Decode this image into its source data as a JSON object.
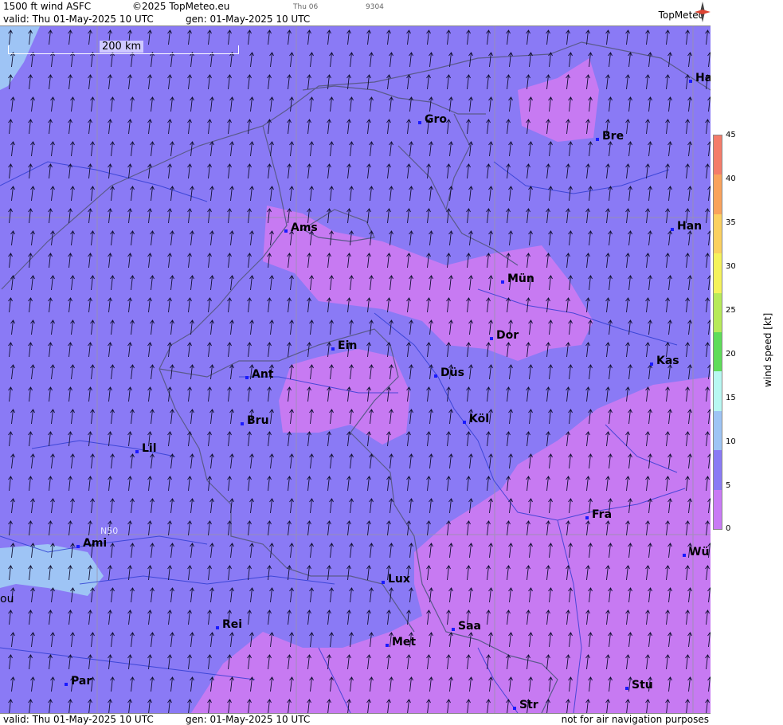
{
  "header": {
    "product": "1500 ft wind ASFC",
    "copyright": "©2025 TopMeteo.eu",
    "valid": "valid:  Thu  01-May-2025  10 UTC",
    "generated": "gen: 01-May-2025 10 UTC",
    "day_tab": "Thu 06",
    "code": "9304",
    "logo": "TopMeteo"
  },
  "footer": {
    "valid": "valid:  Thu  01-May-2025  10 UTC",
    "generated": "gen: 01-May-2025 10 UTC",
    "disclaimer": "not for air navigation purposes"
  },
  "map": {
    "scale_label": "200 km",
    "latitude_label": "N50",
    "cities": [
      "Ha",
      "Gro",
      "Bre",
      "Ams",
      "Han",
      "Mün",
      "Dor",
      "Ein",
      "Kas",
      "Ant",
      "Düs",
      "Bru",
      "Köl",
      "Lil",
      "Fra",
      "Ami",
      "Wü",
      "Lux",
      "ou",
      "Rei",
      "Saa",
      "Met",
      "Par",
      "Stu",
      "Str"
    ]
  },
  "legend": {
    "title": "wind speed [kt]",
    "ticks": [
      "45",
      "40",
      "35",
      "30",
      "25",
      "20",
      "15",
      "10",
      "5",
      "0"
    ],
    "colors": [
      "#f47c6a",
      "#f9a25c",
      "#fbd060",
      "#f5f25c",
      "#b7ea5a",
      "#5fdc5a",
      "#b8f7f2",
      "#9ec4f5",
      "#8a7af5",
      "#c97af5"
    ]
  },
  "colors": {
    "wind_0_5": "#c77af2",
    "wind_5_10": "#8a7af5",
    "wind_10_15": "#9ec4f5"
  }
}
